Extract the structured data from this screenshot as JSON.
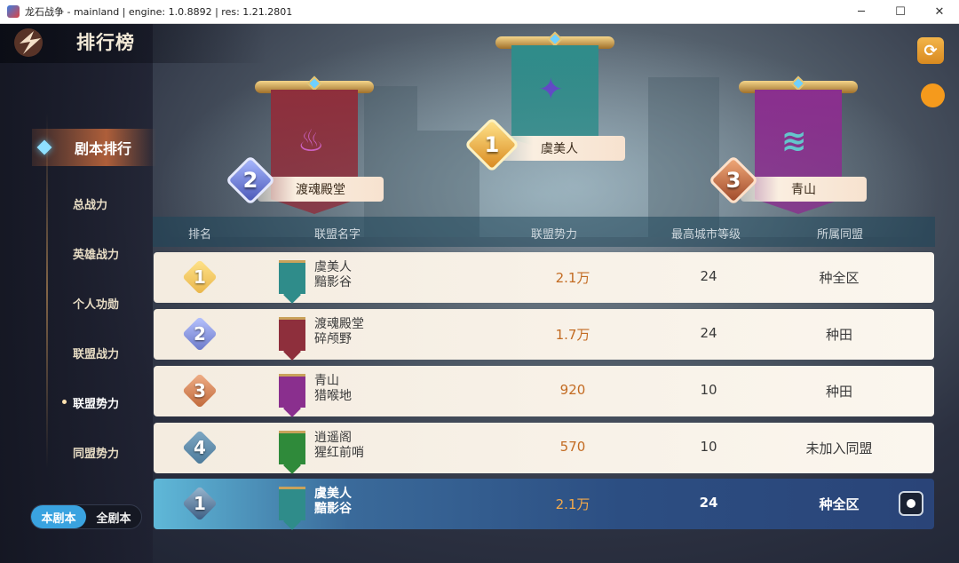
{
  "window": {
    "title": "龙石战争 - mainland | engine: 1.0.8892 | res: 1.21.2801",
    "minimize": "─",
    "maximize": "☐",
    "close": "✕"
  },
  "header": {
    "title": "排行榜"
  },
  "sidebar": {
    "main_tab": "剧本排行",
    "subtabs": [
      "总战力",
      "英雄战力",
      "个人功勋",
      "联盟战力",
      "联盟势力",
      "同盟势力"
    ],
    "active_subtab_index": 4,
    "toggle": {
      "on_label": "本剧本",
      "off_label": "全剧本"
    }
  },
  "podium": [
    {
      "rank": "1",
      "name": "虞美人",
      "banner_color": "#2f8c8a",
      "emblem_color": "#6a3fd0"
    },
    {
      "rank": "2",
      "name": "渡魂殿堂",
      "banner_color": "#8e2f3c",
      "emblem_color": "#d86ad8"
    },
    {
      "rank": "3",
      "name": "青山",
      "banner_color": "#8a2f8e",
      "emblem_color": "#5fe0d8"
    }
  ],
  "table": {
    "headers": [
      "排名",
      "联盟名字",
      "联盟势力",
      "最高城市等级",
      "所属同盟"
    ],
    "rows": [
      {
        "rank": "1",
        "name": "虞美人",
        "sub": "黯影谷",
        "power": "2.1万",
        "level": "24",
        "ally": "种全区",
        "flag_color": "#2f8c8a"
      },
      {
        "rank": "2",
        "name": "渡魂殿堂",
        "sub": "碎颅野",
        "power": "1.7万",
        "level": "24",
        "ally": "种田",
        "flag_color": "#8e2f3c"
      },
      {
        "rank": "3",
        "name": "青山",
        "sub": "猎喉地",
        "power": "920",
        "level": "10",
        "ally": "种田",
        "flag_color": "#8a2f8e"
      },
      {
        "rank": "4",
        "name": "逍遥阁",
        "sub": "猩红前哨",
        "power": "570",
        "level": "10",
        "ally": "未加入同盟",
        "flag_color": "#2f8a3a"
      }
    ],
    "mine": {
      "rank": "1",
      "name": "虞美人",
      "sub": "黯影谷",
      "power": "2.1万",
      "level": "24",
      "ally": "种全区",
      "flag_color": "#2f8c8a"
    }
  },
  "colors": {
    "gold": "#e9b54a",
    "silver": "#6a78c8",
    "bronze": "#c0683a",
    "plain": "#4c7a9a"
  }
}
